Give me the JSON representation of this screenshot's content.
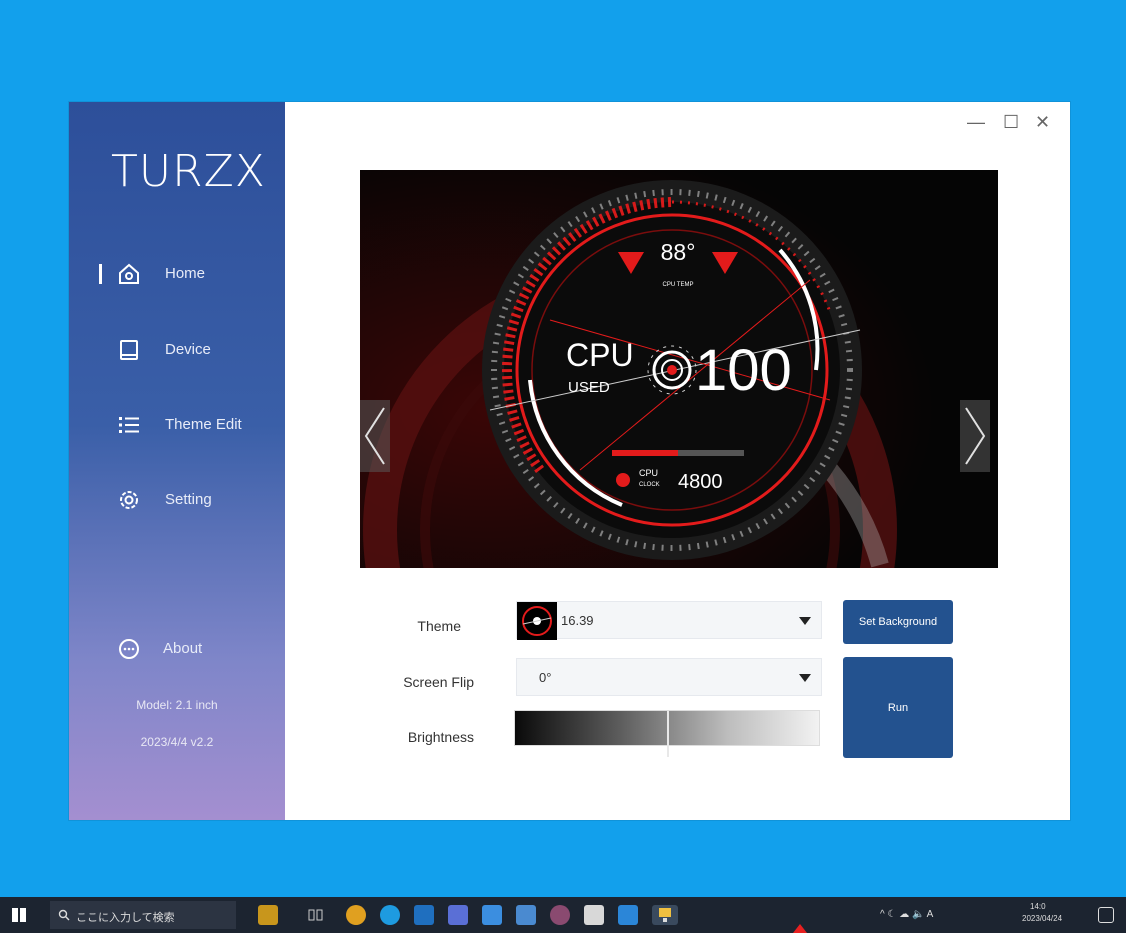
{
  "app": {
    "brand": "TURZX",
    "window_controls": {
      "minimize": "—",
      "maximize": "☐",
      "close": "✕"
    }
  },
  "sidebar": {
    "items": [
      {
        "label": "Home",
        "icon": "home-icon",
        "active": true
      },
      {
        "label": "Device",
        "icon": "device-icon",
        "active": false
      },
      {
        "label": "Theme Edit",
        "icon": "list-icon",
        "active": false
      },
      {
        "label": "Setting",
        "icon": "gear-icon",
        "active": false
      }
    ],
    "about": {
      "label": "About",
      "icon": "about-icon"
    },
    "model": "Model: 2.1 inch",
    "version": "2023/4/4 v2.2"
  },
  "preview": {
    "temp_value": "88°",
    "temp_label": "CPU TEMP",
    "cpu_label": "CPU",
    "used_label": "USED",
    "usage_value": "100",
    "clock_label_1": "CPU",
    "clock_label_2": "CLOCK",
    "clock_value": "4800",
    "usage_fraction": 1.0,
    "clock_bar_fraction": 0.5,
    "accent_color": "#e31b1b"
  },
  "controls": {
    "theme_label": "Theme",
    "theme_value": "16.39",
    "screen_flip_label": "Screen Flip",
    "screen_flip_value": "0°",
    "brightness_label": "Brightness",
    "brightness_fraction": 0.5,
    "set_background_label": "Set Background",
    "run_label": "Run"
  },
  "taskbar": {
    "search_placeholder": "ここに入力して検索",
    "clock_time": "14:0",
    "clock_date": "2023/04/24",
    "tray_text": "^ ☾ ☁ 🔈 A"
  }
}
